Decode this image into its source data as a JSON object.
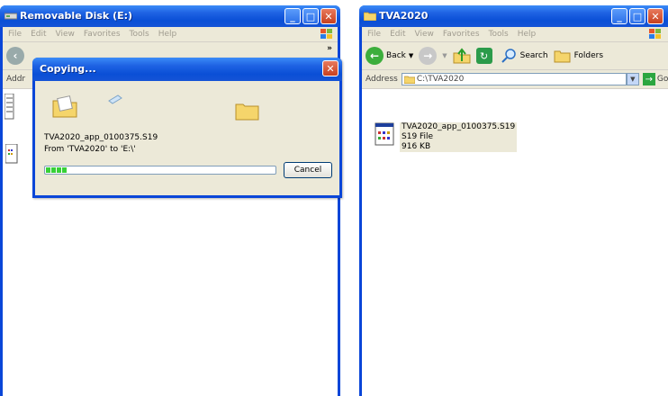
{
  "left_window": {
    "title": "Removable Disk (E:)",
    "menu": [
      "File",
      "Edit",
      "View",
      "Favorites",
      "Tools",
      "Help"
    ],
    "address_label": "Addr",
    "chevron": "»"
  },
  "right_window": {
    "title": "TVA2020",
    "menu": [
      "File",
      "Edit",
      "View",
      "Favorites",
      "Tools",
      "Help"
    ],
    "toolbar": {
      "back": "Back",
      "search": "Search",
      "folders": "Folders"
    },
    "address_label": "Address",
    "address_value": "C:\\TVA2020",
    "go": "Go",
    "file": {
      "name": "TVA2020_app_0100375.S19",
      "type": "S19 File",
      "size": "916 KB"
    }
  },
  "dialog": {
    "title": "Copying...",
    "filename": "TVA2020_app_0100375.S19",
    "from_to": "From 'TVA2020' to 'E:\\'",
    "cancel": "Cancel",
    "progress": 0.1
  },
  "colors": {
    "titlebar": "#0a4fd6",
    "progress": "#38d038",
    "chrome": "#ece9d8"
  }
}
